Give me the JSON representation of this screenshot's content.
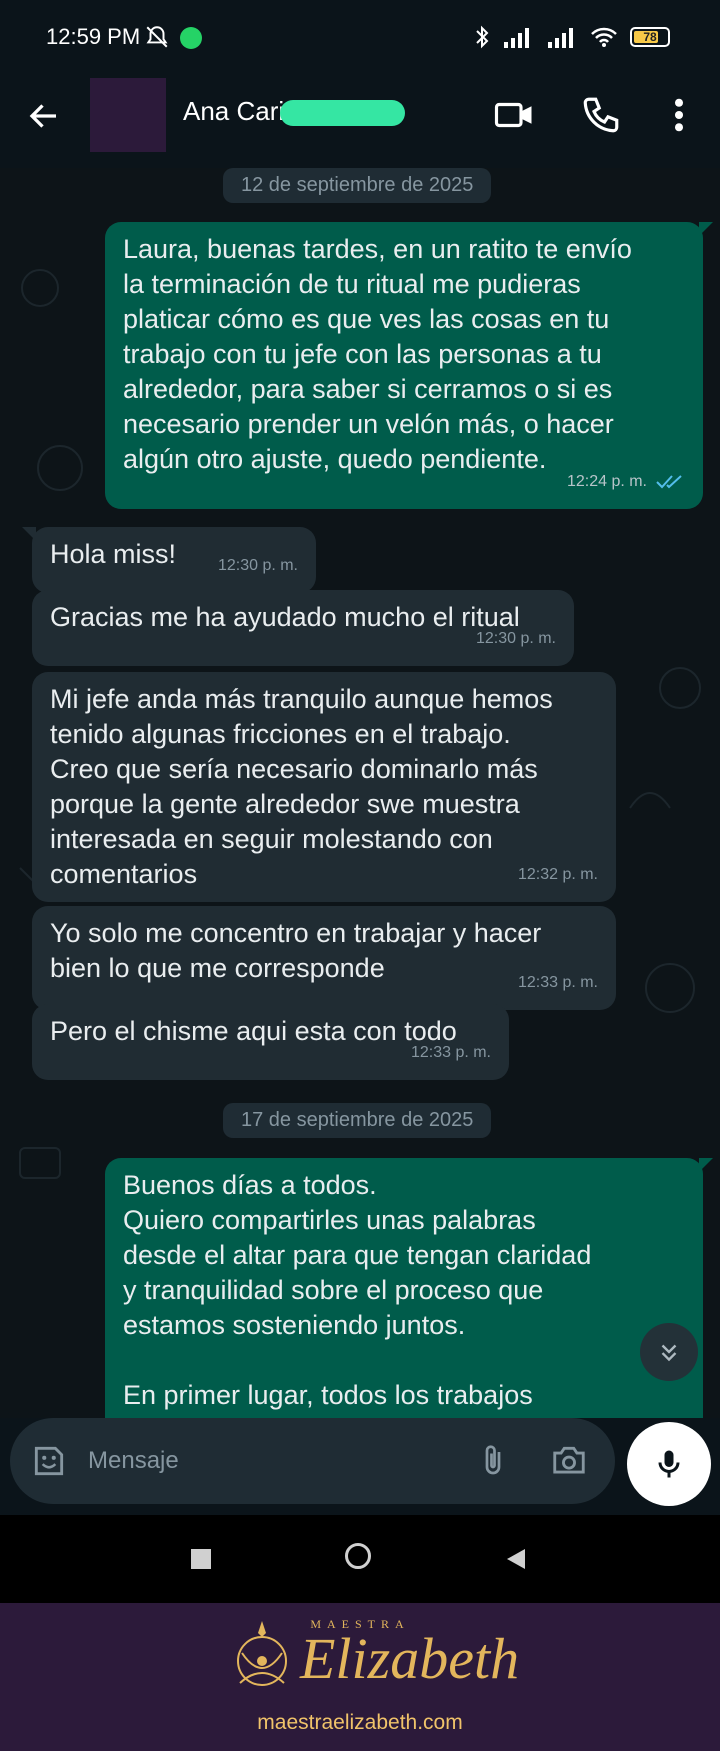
{
  "status_bar": {
    "time": "12:59 PM",
    "battery": "78"
  },
  "header": {
    "contact_name": "Ana Cari"
  },
  "dates": [
    "12 de septiembre de 2025",
    "17 de septiembre de 2025"
  ],
  "messages": [
    {
      "dir": "out",
      "text": "Laura, buenas tardes, en un ratito te envío\nla terminación de tu ritual me pudieras\nplaticar cómo es que ves las cosas en tu\ntrabajo con tu jefe con las personas a tu\nalrededor, para saber si cerramos o si es\nnecesario prender un velón más, o hacer\nalgún otro ajuste, quedo pendiente.",
      "time": "12:24 p. m."
    },
    {
      "dir": "in",
      "text": "Hola miss!",
      "time": "12:30 p. m."
    },
    {
      "dir": "in",
      "text": "Gracias me ha ayudado mucho el ritual",
      "time": "12:30 p. m."
    },
    {
      "dir": "in",
      "text": "Mi jefe anda más tranquilo aunque hemos\ntenido algunas fricciones en el trabajo.\nCreo que sería necesario dominarlo más\nporque la gente alrededor swe muestra\ninteresada en seguir molestando con\ncomentarios",
      "time": "12:32 p. m."
    },
    {
      "dir": "in",
      "text": "Yo solo me concentro en trabajar y hacer\nbien lo que me corresponde",
      "time": "12:33 p. m."
    },
    {
      "dir": "in",
      "text": "Pero el chisme aqui esta con todo",
      "time": "12:33 p. m."
    },
    {
      "dir": "out",
      "text": "Buenos días a todos.\nQuiero compartirles unas palabras\ndesde el altar para que tengan claridad\ny tranquilidad sobre el proceso que\nestamos sosteniendo juntos.\n\nEn primer lugar, todos los trabajos",
      "time": ""
    }
  ],
  "input": {
    "placeholder": "Mensaje"
  },
  "brand": {
    "small": "MAESTRA",
    "name": "Elizabeth",
    "url": "maestraelizabeth.com"
  },
  "colors": {
    "bg": "#0b141a",
    "outgoing": "#005c4b",
    "incoming": "#202c33",
    "brand_bg": "#2c1a3a",
    "gold": "#e3b65c"
  }
}
